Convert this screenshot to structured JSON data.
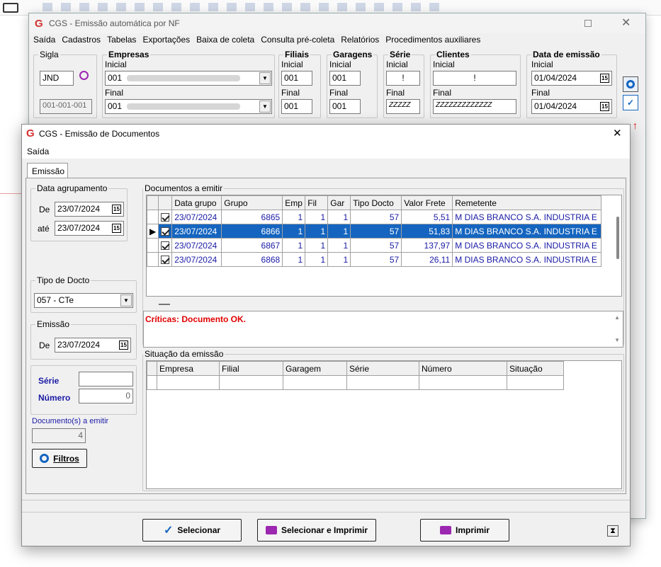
{
  "bg_window": {
    "title": "CGS - Emissão automática por NF",
    "menu": [
      "Saída",
      "Cadastros",
      "Tabelas",
      "Exportações",
      "Baixa de coleta",
      "Consulta pré-coleta",
      "Relatórios",
      "Procedimentos auxiliares"
    ],
    "sigla": {
      "title": "Sigla",
      "value": "JND",
      "code": "001-001-001"
    },
    "empresas": {
      "title": "Empresas",
      "inicial_label": "Inicial",
      "inicial": "001",
      "final_label": "Final",
      "final": "001"
    },
    "filiais": {
      "title": "Filiais",
      "inicial_label": "Inicial",
      "inicial": "001",
      "final_label": "Final",
      "final": "001"
    },
    "garagens": {
      "title": "Garagens",
      "inicial_label": "Inicial",
      "inicial": "001",
      "final_label": "Final",
      "final": "001"
    },
    "serie": {
      "title": "Série",
      "inicial_label": "Inicial",
      "inicial": "!",
      "final_label": "Final",
      "final": "ZZZZZ"
    },
    "clientes": {
      "title": "Clientes",
      "inicial_label": "Inicial",
      "inicial": "!",
      "final_label": "Final",
      "final": "ZZZZZZZZZZZZZ"
    },
    "data_emissao": {
      "title": "Data de emissão",
      "inicial_label": "Inicial",
      "inicial": "01/04/2024",
      "final_label": "Final",
      "final": "01/04/2024"
    }
  },
  "dialog": {
    "title": "CGS - Emissão de Documentos",
    "menu": "Saída",
    "tab": "Emissão",
    "data_agrupamento": {
      "title": "Data agrupamento",
      "de_label": "De",
      "de": "23/07/2024",
      "ate_label": "até",
      "ate": "23/07/2024"
    },
    "tipo_docto": {
      "title": "Tipo de Docto",
      "value": "057 - CTe"
    },
    "emissao": {
      "title": "Emissão",
      "de_label": "De",
      "de": "23/07/2024"
    },
    "serie_label": "Série",
    "serie_value": "",
    "numero_label": "Número",
    "numero_value": "0",
    "docs_label": "Documento(s) a emitir",
    "docs_value": "4",
    "filtros_label": "Filtros",
    "documentos": {
      "title": "Documentos a emitir",
      "columns": [
        "Data grupo",
        "Grupo",
        "Emp",
        "Fil",
        "Gar",
        "Tipo Docto",
        "Valor Frete",
        "Remetente"
      ],
      "rows": [
        {
          "data": "23/07/2024",
          "grupo": "6865",
          "emp": "1",
          "fil": "1",
          "gar": "1",
          "tipo": "57",
          "valor": "5,51",
          "remetente": "M DIAS BRANCO S.A. INDUSTRIA E"
        },
        {
          "data": "23/07/2024",
          "grupo": "6866",
          "emp": "1",
          "fil": "1",
          "gar": "1",
          "tipo": "57",
          "valor": "51,83",
          "remetente": "M DIAS BRANCO S.A. INDUSTRIA E"
        },
        {
          "data": "23/07/2024",
          "grupo": "6867",
          "emp": "1",
          "fil": "1",
          "gar": "1",
          "tipo": "57",
          "valor": "137,97",
          "remetente": "M DIAS BRANCO S.A. INDUSTRIA E"
        },
        {
          "data": "23/07/2024",
          "grupo": "6868",
          "emp": "1",
          "fil": "1",
          "gar": "1",
          "tipo": "57",
          "valor": "26,11",
          "remetente": "M DIAS BRANCO S.A. INDUSTRIA E"
        }
      ]
    },
    "criticas": "Críticas: Documento OK.",
    "situacao": {
      "title": "Situação da emissão",
      "columns": [
        "Empresa",
        "Filial",
        "Garagem",
        "Série",
        "Número",
        "Situação"
      ]
    },
    "buttons": {
      "selecionar": "Selecionar",
      "selecionar_imprimir": "Selecionar e Imprimir",
      "imprimir": "Imprimir"
    }
  },
  "colors": {
    "accent": "#1565c0",
    "error": "#e00000",
    "link_blue": "#1a1aa6"
  }
}
